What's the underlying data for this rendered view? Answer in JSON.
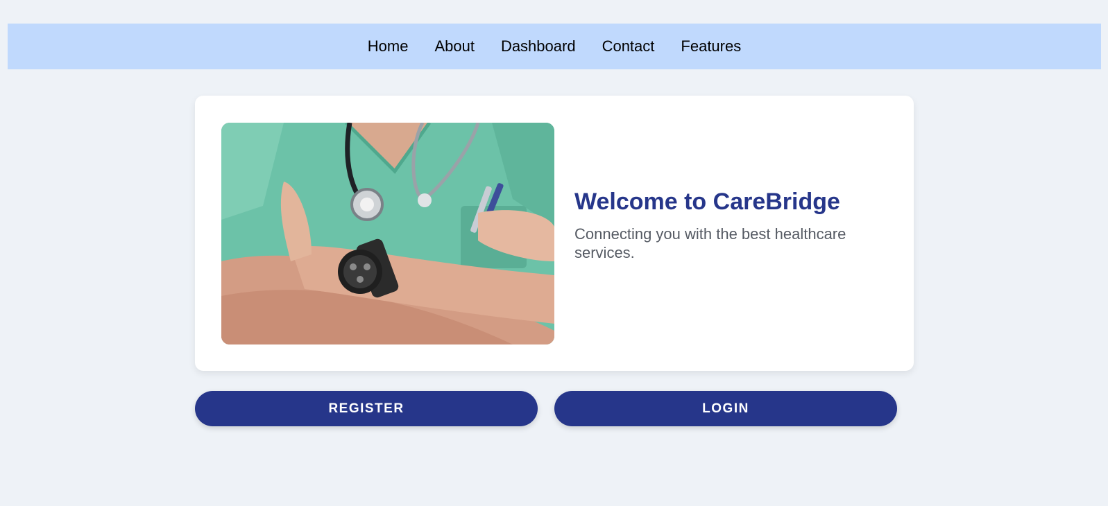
{
  "nav": {
    "items": [
      {
        "label": "Home"
      },
      {
        "label": "About"
      },
      {
        "label": "Dashboard"
      },
      {
        "label": "Contact"
      },
      {
        "label": "Features"
      }
    ]
  },
  "hero": {
    "title": "Welcome to CareBridge",
    "subtitle": "Connecting you with the best healthcare services.",
    "image_icon": "doctor-photo"
  },
  "actions": {
    "register_label": "REGISTER",
    "login_label": "LOGIN"
  },
  "colors": {
    "page_background": "#eef2f7",
    "nav_background": "#c0d9fd",
    "accent": "#26368a",
    "subtitle_text": "#555a63"
  }
}
